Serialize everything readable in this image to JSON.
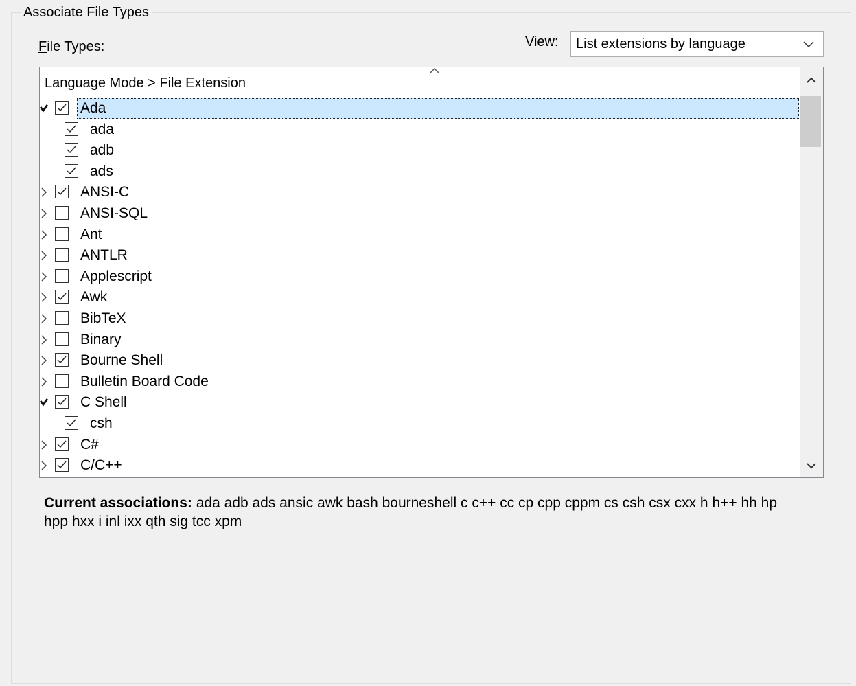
{
  "group": {
    "title": "Associate File Types"
  },
  "file_types_label": {
    "prefix": "F",
    "rest": "ile Types:"
  },
  "view": {
    "label": "View:",
    "selected": "List extensions by language"
  },
  "tree": {
    "column_header": "Language Mode > File Extension",
    "rows": [
      {
        "label": "Ada",
        "level": 0,
        "checked": true,
        "expander": "expanded",
        "selected": true
      },
      {
        "label": "ada",
        "level": 1,
        "checked": true
      },
      {
        "label": "adb",
        "level": 1,
        "checked": true
      },
      {
        "label": "ads",
        "level": 1,
        "checked": true
      },
      {
        "label": "ANSI-C",
        "level": 0,
        "checked": true,
        "expander": "collapsed"
      },
      {
        "label": "ANSI-SQL",
        "level": 0,
        "checked": false,
        "expander": "collapsed"
      },
      {
        "label": "Ant",
        "level": 0,
        "checked": false,
        "expander": "collapsed"
      },
      {
        "label": "ANTLR",
        "level": 0,
        "checked": false,
        "expander": "collapsed"
      },
      {
        "label": "Applescript",
        "level": 0,
        "checked": false,
        "expander": "collapsed"
      },
      {
        "label": "Awk",
        "level": 0,
        "checked": true,
        "expander": "collapsed"
      },
      {
        "label": "BibTeX",
        "level": 0,
        "checked": false,
        "expander": "collapsed"
      },
      {
        "label": "Binary",
        "level": 0,
        "checked": false,
        "expander": "collapsed"
      },
      {
        "label": "Bourne Shell",
        "level": 0,
        "checked": true,
        "expander": "collapsed"
      },
      {
        "label": "Bulletin Board Code",
        "level": 0,
        "checked": false,
        "expander": "collapsed"
      },
      {
        "label": "C Shell",
        "level": 0,
        "checked": true,
        "expander": "expanded"
      },
      {
        "label": "csh",
        "level": 1,
        "checked": true
      },
      {
        "label": "C#",
        "level": 0,
        "checked": true,
        "expander": "collapsed"
      },
      {
        "label": "C/C++",
        "level": 0,
        "checked": true,
        "expander": "collapsed"
      }
    ]
  },
  "associations": {
    "label": "Current associations:",
    "value": "ada adb ads ansic awk bash bourneshell c c++ cc cp cpp cppm cs csh csx cxx h h++ hh hp hpp hxx i inl ixx qth sig tcc xpm"
  },
  "icons": {
    "expanded": "chevron-down-icon",
    "collapsed": "chevron-right-icon",
    "check": "checkmark-icon",
    "dropdown": "chevron-down-icon",
    "sort": "sort-ascending-icon"
  },
  "colors": {
    "selection": "#cce8ff",
    "background": "#f0f0f0"
  }
}
